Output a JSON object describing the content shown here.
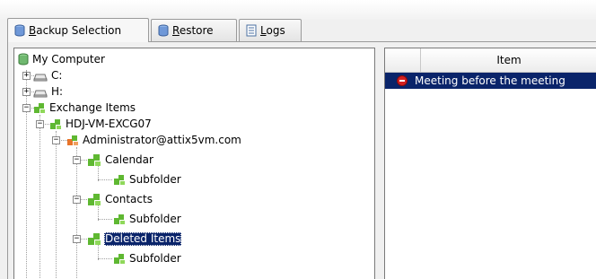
{
  "tabs": [
    {
      "prefix": "",
      "accel": "B",
      "rest": "ackup Selection",
      "active": true,
      "icon": "database-icon"
    },
    {
      "prefix": "",
      "accel": "R",
      "rest": "estore",
      "active": false,
      "icon": "database-icon"
    },
    {
      "prefix": "",
      "accel": "L",
      "rest": "ogs",
      "active": false,
      "icon": "document-icon"
    }
  ],
  "tree": {
    "root": "My Computer",
    "drive_c": "C:",
    "drive_h": "H:",
    "exchange": "Exchange Items",
    "server": "HDJ-VM-EXCG07",
    "mailbox": "Administrator@attix5vm.com",
    "calendar": "Calendar",
    "calendar_sub": "Subfolder",
    "contacts": "Contacts",
    "contacts_sub": "Subfolder",
    "deleted": "Deleted Items",
    "deleted_sub": "Subfolder"
  },
  "list": {
    "column_item": "Item",
    "rows": [
      {
        "status_icon": "stop-icon",
        "text": "Meeting before the meeting"
      }
    ]
  },
  "colors": {
    "selection": "#0a246a",
    "exchange_green": "#5fb832",
    "mailbox_orange": "#e8742a",
    "stop_red": "#d42020"
  }
}
